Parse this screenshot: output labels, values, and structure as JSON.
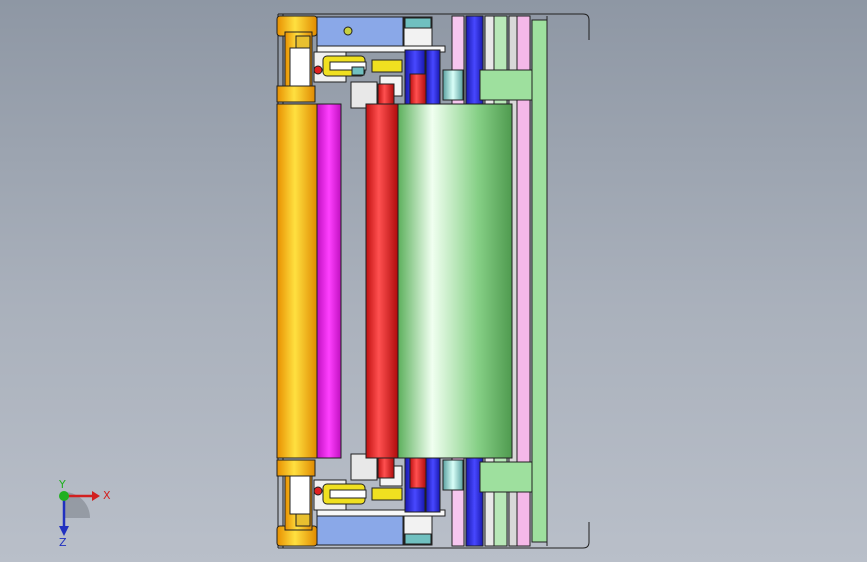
{
  "viewport": {
    "colors": {
      "background_top": "#8e97a4",
      "background_bottom": "#b9bfc9",
      "roller_yellow": "#f0a800",
      "roller_magenta": "#e020e0",
      "roller_red": "#e02020",
      "roller_green": "#7ad47a",
      "plate_blue": "#2b2bd6",
      "plate_pink": "#f4b8e8",
      "plate_green": "#9ee09e",
      "bracket_blue": "#8aa8e8",
      "bracket_yellow": "#f0e020",
      "outline": "#202020"
    }
  },
  "triad": {
    "x_label": "X",
    "y_label": "Y",
    "z_label": "Z",
    "x_color": "#d22020",
    "y_color": "#20b020",
    "z_color": "#2030c0"
  }
}
